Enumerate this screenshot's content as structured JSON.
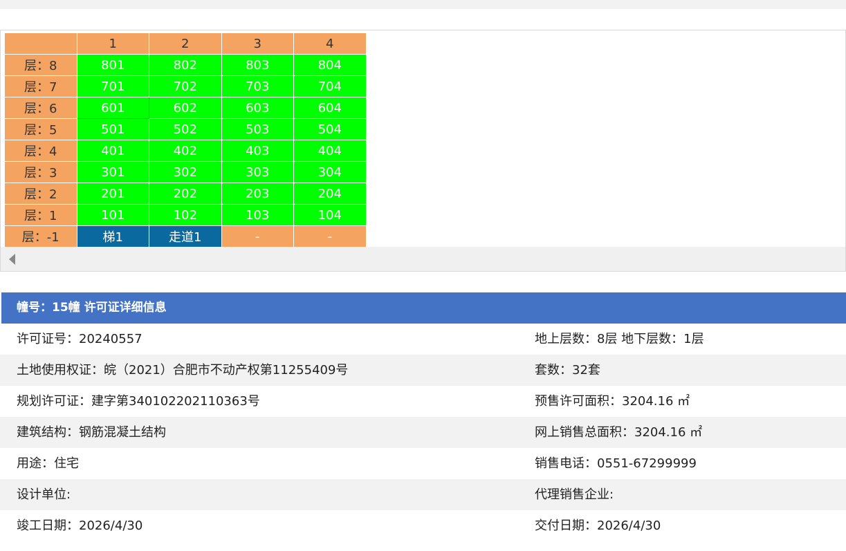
{
  "grid": {
    "columns": [
      "",
      "1",
      "2",
      "3",
      "4"
    ],
    "rows": [
      {
        "floor": "层：8",
        "cells": [
          {
            "text": "801",
            "kind": "green"
          },
          {
            "text": "802",
            "kind": "green"
          },
          {
            "text": "803",
            "kind": "green"
          },
          {
            "text": "804",
            "kind": "green"
          }
        ]
      },
      {
        "floor": "层：7",
        "cells": [
          {
            "text": "701",
            "kind": "green"
          },
          {
            "text": "702",
            "kind": "green"
          },
          {
            "text": "703",
            "kind": "green"
          },
          {
            "text": "704",
            "kind": "green"
          }
        ]
      },
      {
        "floor": "层：6",
        "cells": [
          {
            "text": "601",
            "kind": "green",
            "selected": true
          },
          {
            "text": "602",
            "kind": "green"
          },
          {
            "text": "603",
            "kind": "green"
          },
          {
            "text": "604",
            "kind": "green"
          }
        ]
      },
      {
        "floor": "层：5",
        "cells": [
          {
            "text": "501",
            "kind": "green"
          },
          {
            "text": "502",
            "kind": "green"
          },
          {
            "text": "503",
            "kind": "green"
          },
          {
            "text": "504",
            "kind": "green"
          }
        ]
      },
      {
        "floor": "层：4",
        "cells": [
          {
            "text": "401",
            "kind": "green"
          },
          {
            "text": "402",
            "kind": "green"
          },
          {
            "text": "403",
            "kind": "green"
          },
          {
            "text": "404",
            "kind": "green"
          }
        ]
      },
      {
        "floor": "层：3",
        "cells": [
          {
            "text": "301",
            "kind": "green"
          },
          {
            "text": "302",
            "kind": "green"
          },
          {
            "text": "303",
            "kind": "green"
          },
          {
            "text": "304",
            "kind": "green"
          }
        ]
      },
      {
        "floor": "层：2",
        "cells": [
          {
            "text": "201",
            "kind": "green"
          },
          {
            "text": "202",
            "kind": "green"
          },
          {
            "text": "203",
            "kind": "green"
          },
          {
            "text": "204",
            "kind": "green"
          }
        ]
      },
      {
        "floor": "层：1",
        "cells": [
          {
            "text": "101",
            "kind": "green"
          },
          {
            "text": "102",
            "kind": "green"
          },
          {
            "text": "103",
            "kind": "green"
          },
          {
            "text": "104",
            "kind": "green"
          }
        ]
      },
      {
        "floor": "层：-1",
        "cells": [
          {
            "text": "梯1",
            "kind": "blue"
          },
          {
            "text": "走道1",
            "kind": "blue"
          },
          {
            "text": "-",
            "kind": "orange"
          },
          {
            "text": "-",
            "kind": "orange"
          }
        ]
      }
    ],
    "colors": {
      "header": "#f4a460",
      "available": "#00ff00",
      "facility": "#0a6aa0"
    }
  },
  "scrollbar": {
    "icon": "chevron-left-icon"
  },
  "panel": {
    "title": "幢号：15幢 许可证详细信息",
    "rows": [
      {
        "left": "许可证号：20240557",
        "right": "地上层数：8层  地下层数：1层"
      },
      {
        "left": "土地使用权证：皖（2021）合肥市不动产权第11255409号",
        "right": "套数：32套"
      },
      {
        "left": "规划许可证：建字第340102202110363号",
        "right": "预售许可面积：3204.16 ㎡"
      },
      {
        "left": "建筑结构：钢筋混凝土结构",
        "right": "网上销售总面积：3204.16 ㎡"
      },
      {
        "left": "用途：住宅",
        "right": "销售电话：0551-67299999"
      },
      {
        "left": "设计单位:",
        "right": "代理销售企业:"
      },
      {
        "left": "竣工日期：2026/4/30",
        "right": "交付日期：2026/4/30"
      }
    ],
    "color": "#4472c4"
  }
}
